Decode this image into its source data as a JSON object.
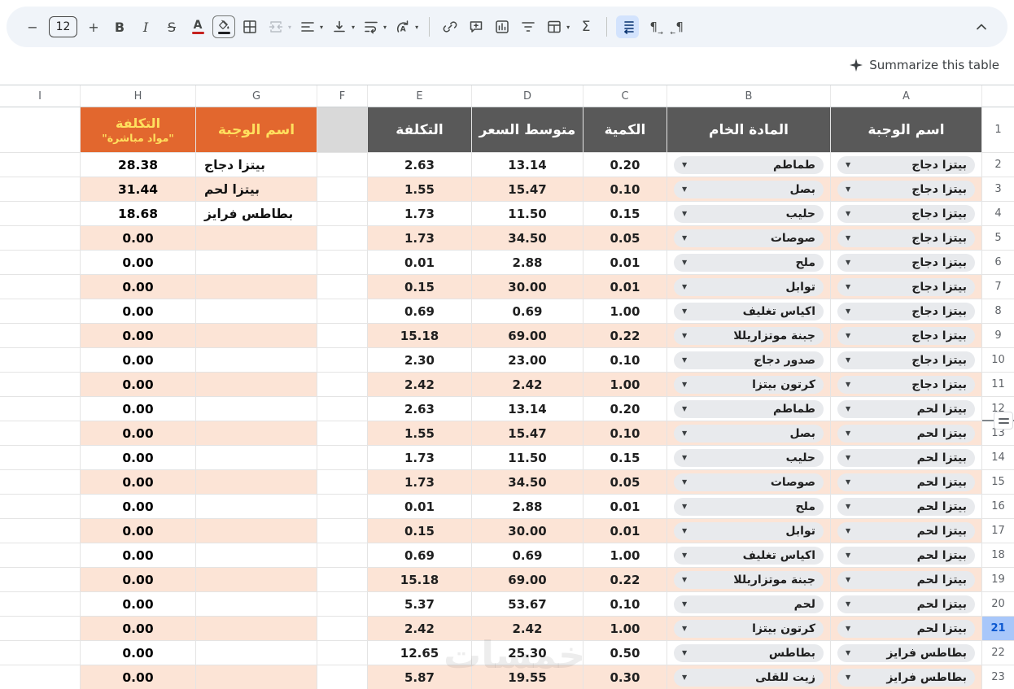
{
  "toolbar": {
    "font_size_value": "12",
    "minus_label": "−",
    "plus_label": "+",
    "bold_label": "B",
    "italic_label": "I",
    "strikethrough_label": "S",
    "text_color_label": "A",
    "functions_label": "Σ",
    "pilcrow_label": "¶"
  },
  "actions": {
    "summarize_label": "Summarize this table"
  },
  "sheet": {
    "column_letters": [
      "I",
      "H",
      "G",
      "F",
      "E",
      "D",
      "C",
      "B",
      "A"
    ],
    "header_row_number": "1",
    "selected_row_number": 21,
    "frozen_divider_after_row": 12,
    "headers": {
      "meal_name": "اسم الوجبة",
      "raw_material": "المادة الخام",
      "quantity": "الكمية",
      "avg_price": "متوسط السعر",
      "cost": "التكلفة",
      "summary_meal_name": "اسم الوجبة",
      "summary_cost_line1": "التكلفة",
      "summary_cost_line2": "\"مواد مباشرة\""
    },
    "rows": [
      {
        "row": 2,
        "a": "بيتزا دجاج",
        "b": "طماطم",
        "c": "0.20",
        "d": "13.14",
        "e": "2.63",
        "g": "بيتزا دجاج",
        "h": "28.38"
      },
      {
        "row": 3,
        "a": "بيتزا دجاج",
        "b": "بصل",
        "c": "0.10",
        "d": "15.47",
        "e": "1.55",
        "g": "بيتزا لحم",
        "h": "31.44"
      },
      {
        "row": 4,
        "a": "بيتزا دجاج",
        "b": "حليب",
        "c": "0.15",
        "d": "11.50",
        "e": "1.73",
        "g": "بطاطس فرايز",
        "h": "18.68"
      },
      {
        "row": 5,
        "a": "بيتزا دجاج",
        "b": "صوصات",
        "c": "0.05",
        "d": "34.50",
        "e": "1.73",
        "g": "",
        "h": "0.00"
      },
      {
        "row": 6,
        "a": "بيتزا دجاج",
        "b": "ملح",
        "c": "0.01",
        "d": "2.88",
        "e": "0.01",
        "g": "",
        "h": "0.00"
      },
      {
        "row": 7,
        "a": "بيتزا دجاج",
        "b": "توابل",
        "c": "0.01",
        "d": "30.00",
        "e": "0.15",
        "g": "",
        "h": "0.00"
      },
      {
        "row": 8,
        "a": "بيتزا دجاج",
        "b": "اكياس تغليف",
        "c": "1.00",
        "d": "0.69",
        "e": "0.69",
        "g": "",
        "h": "0.00"
      },
      {
        "row": 9,
        "a": "بيتزا دجاج",
        "b": "جبنة موتزاريللا",
        "c": "0.22",
        "d": "69.00",
        "e": "15.18",
        "g": "",
        "h": "0.00"
      },
      {
        "row": 10,
        "a": "بيتزا دجاج",
        "b": "صدور دجاج",
        "c": "0.10",
        "d": "23.00",
        "e": "2.30",
        "g": "",
        "h": "0.00"
      },
      {
        "row": 11,
        "a": "بيتزا دجاج",
        "b": "كرتون بيتزا",
        "c": "1.00",
        "d": "2.42",
        "e": "2.42",
        "g": "",
        "h": "0.00"
      },
      {
        "row": 12,
        "a": "بيتزا لحم",
        "b": "طماطم",
        "c": "0.20",
        "d": "13.14",
        "e": "2.63",
        "g": "",
        "h": "0.00"
      },
      {
        "row": 13,
        "a": "بيتزا لحم",
        "b": "بصل",
        "c": "0.10",
        "d": "15.47",
        "e": "1.55",
        "g": "",
        "h": "0.00"
      },
      {
        "row": 14,
        "a": "بيتزا لحم",
        "b": "حليب",
        "c": "0.15",
        "d": "11.50",
        "e": "1.73",
        "g": "",
        "h": "0.00"
      },
      {
        "row": 15,
        "a": "بيتزا لحم",
        "b": "صوصات",
        "c": "0.05",
        "d": "34.50",
        "e": "1.73",
        "g": "",
        "h": "0.00"
      },
      {
        "row": 16,
        "a": "بيتزا لحم",
        "b": "ملح",
        "c": "0.01",
        "d": "2.88",
        "e": "0.01",
        "g": "",
        "h": "0.00"
      },
      {
        "row": 17,
        "a": "بيتزا لحم",
        "b": "توابل",
        "c": "0.01",
        "d": "30.00",
        "e": "0.15",
        "g": "",
        "h": "0.00"
      },
      {
        "row": 18,
        "a": "بيتزا لحم",
        "b": "اكياس تغليف",
        "c": "1.00",
        "d": "0.69",
        "e": "0.69",
        "g": "",
        "h": "0.00"
      },
      {
        "row": 19,
        "a": "بيتزا لحم",
        "b": "جبنة موتزاريللا",
        "c": "0.22",
        "d": "69.00",
        "e": "15.18",
        "g": "",
        "h": "0.00"
      },
      {
        "row": 20,
        "a": "بيتزا لحم",
        "b": "لحم",
        "c": "0.10",
        "d": "53.67",
        "e": "5.37",
        "g": "",
        "h": "0.00"
      },
      {
        "row": 21,
        "a": "بيتزا لحم",
        "b": "كرتون بيتزا",
        "c": "1.00",
        "d": "2.42",
        "e": "2.42",
        "g": "",
        "h": "0.00"
      },
      {
        "row": 22,
        "a": "بطاطس فرايز",
        "b": "بطاطس",
        "c": "0.50",
        "d": "25.30",
        "e": "12.65",
        "g": "",
        "h": "0.00"
      },
      {
        "row": 23,
        "a": "بطاطس فرايز",
        "b": "زيت للقلى",
        "c": "0.30",
        "d": "19.55",
        "e": "5.87",
        "g": "",
        "h": "0.00"
      }
    ]
  },
  "watermark": "خمسات",
  "colors": {
    "header_gray": "#595959",
    "header_orange": "#e2672e",
    "orange_text": "#ffe05e",
    "row_band": "#fce4d6",
    "selection_blue": "#a8c7fa",
    "toolbar_bg": "#f0f4f9",
    "active_button_bg": "#d3e3fd"
  }
}
